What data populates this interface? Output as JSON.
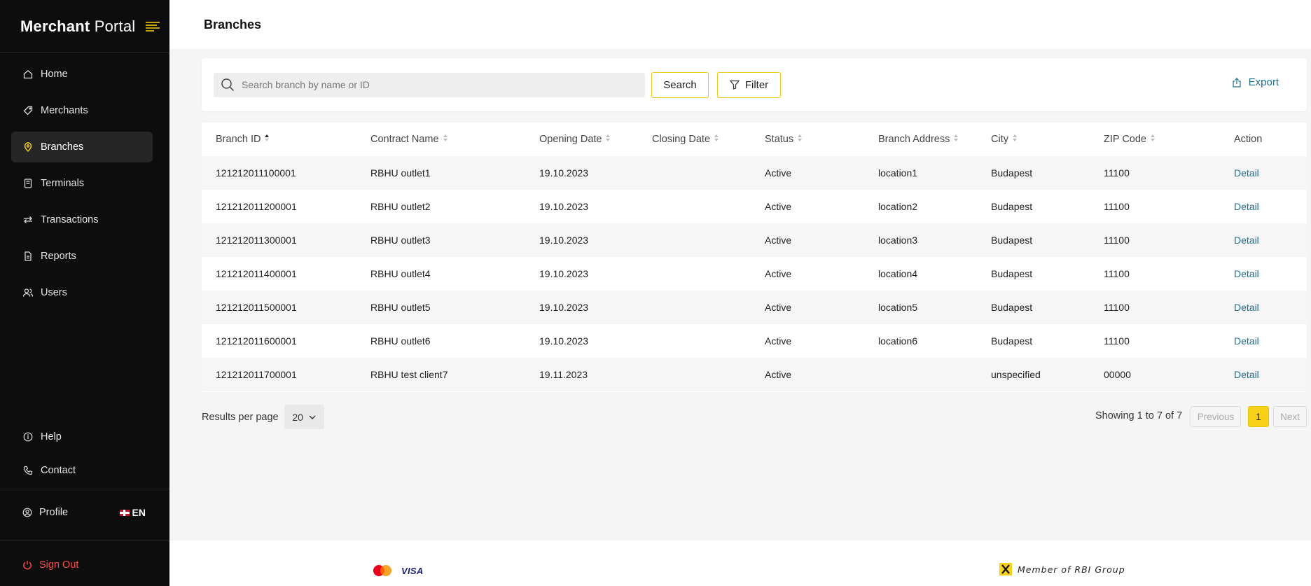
{
  "sidebar": {
    "brand_bold": "Merchant",
    "brand_light": "Portal",
    "nav": [
      {
        "label": "Home",
        "icon": "home-icon"
      },
      {
        "label": "Merchants",
        "icon": "tag-icon"
      },
      {
        "label": "Branches",
        "icon": "location-pin-icon",
        "active": true
      },
      {
        "label": "Terminals",
        "icon": "terminal-icon"
      },
      {
        "label": "Transactions",
        "icon": "transfer-arrows-icon"
      },
      {
        "label": "Reports",
        "icon": "document-icon"
      },
      {
        "label": "Users",
        "icon": "users-icon"
      }
    ],
    "bottom": [
      {
        "label": "Help",
        "icon": "info-icon"
      },
      {
        "label": "Contact",
        "icon": "phone-icon"
      }
    ],
    "profile_label": "Profile",
    "language": "EN",
    "signout_label": "Sign Out"
  },
  "header": {
    "title": "Branches"
  },
  "toolbar": {
    "search_placeholder": "Search branch by name or ID",
    "search_label": "Search",
    "filter_label": "Filter",
    "export_label": "Export"
  },
  "table": {
    "columns": [
      "Branch ID",
      "Contract Name",
      "Opening Date",
      "Closing Date",
      "Status",
      "Branch Address",
      "City",
      "ZIP Code",
      "Action"
    ],
    "sorted_column": "Branch ID",
    "rows": [
      {
        "id": "121212011100001",
        "contract": "RBHU outlet1",
        "opening": "19.10.2023",
        "closing": "",
        "status": "Active",
        "address": "location1",
        "city": "Budapest",
        "zip": "11100",
        "action": "Detail"
      },
      {
        "id": "121212011200001",
        "contract": "RBHU outlet2",
        "opening": "19.10.2023",
        "closing": "",
        "status": "Active",
        "address": "location2",
        "city": "Budapest",
        "zip": "11100",
        "action": "Detail"
      },
      {
        "id": "121212011300001",
        "contract": "RBHU outlet3",
        "opening": "19.10.2023",
        "closing": "",
        "status": "Active",
        "address": "location3",
        "city": "Budapest",
        "zip": "11100",
        "action": "Detail"
      },
      {
        "id": "121212011400001",
        "contract": "RBHU outlet4",
        "opening": "19.10.2023",
        "closing": "",
        "status": "Active",
        "address": "location4",
        "city": "Budapest",
        "zip": "11100",
        "action": "Detail"
      },
      {
        "id": "121212011500001",
        "contract": "RBHU outlet5",
        "opening": "19.10.2023",
        "closing": "",
        "status": "Active",
        "address": "location5",
        "city": "Budapest",
        "zip": "11100",
        "action": "Detail"
      },
      {
        "id": "121212011600001",
        "contract": "RBHU outlet6",
        "opening": "19.10.2023",
        "closing": "",
        "status": "Active",
        "address": "location6",
        "city": "Budapest",
        "zip": "11100",
        "action": "Detail"
      },
      {
        "id": "121212011700001",
        "contract": "RBHU test client7",
        "opening": "19.11.2023",
        "closing": "",
        "status": "Active",
        "address": "",
        "city": "unspecified",
        "zip": "00000",
        "action": "Detail"
      }
    ]
  },
  "pagination": {
    "results_label": "Results per page",
    "per_page": "20",
    "showing": "Showing 1 to 7 of 7",
    "prev": "Previous",
    "current_page": "1",
    "next": "Next"
  },
  "footer": {
    "visa": "VISA",
    "rbi_text": "Member of RBI Group"
  },
  "colors": {
    "sidebar_bg": "#0d0d0d",
    "accent_yellow": "#f7d117",
    "link_teal": "#1f6f8b",
    "signout_red": "#ff4a4a"
  }
}
